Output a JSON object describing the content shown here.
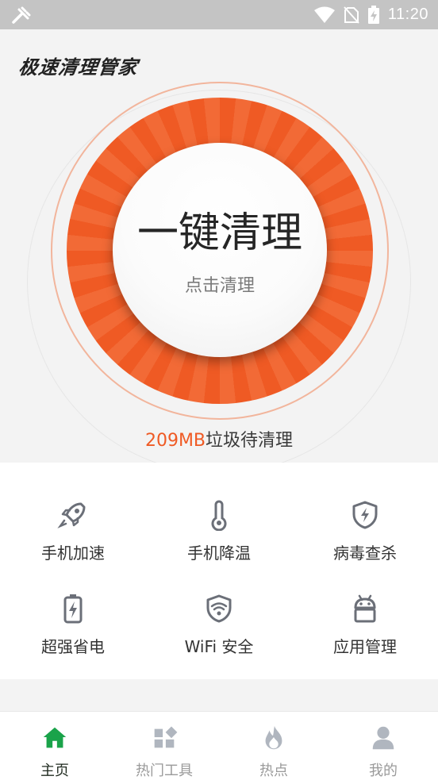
{
  "status_bar": {
    "time": "11:20",
    "icons": [
      "debug-icon",
      "wifi-icon",
      "no-sim-icon",
      "battery-icon"
    ]
  },
  "app": {
    "title": "极速清理管家"
  },
  "hero": {
    "clean_button_title": "一键清理",
    "clean_button_subtitle": "点击清理",
    "junk_amount": "209MB",
    "junk_suffix": "垃圾待清理"
  },
  "tools": [
    {
      "label": "手机加速",
      "icon": "rocket-icon"
    },
    {
      "label": "手机降温",
      "icon": "thermometer-icon"
    },
    {
      "label": "病毒查杀",
      "icon": "shield-bolt-icon"
    },
    {
      "label": "超强省电",
      "icon": "battery-bolt-icon"
    },
    {
      "label": "WiFi 安全",
      "icon": "wifi-shield-icon"
    },
    {
      "label": "应用管理",
      "icon": "android-icon"
    }
  ],
  "bottom_nav": [
    {
      "label": "主页",
      "icon": "home-icon",
      "active": true
    },
    {
      "label": "热门工具",
      "icon": "apps-icon",
      "active": false
    },
    {
      "label": "热点",
      "icon": "flame-icon",
      "active": false
    },
    {
      "label": "我的",
      "icon": "profile-icon",
      "active": false
    }
  ],
  "colors": {
    "accent": "#ef5a24",
    "nav_active": "#1aa34a",
    "nav_inactive": "#b0b6bf",
    "tool_icon": "#6b6f78"
  }
}
